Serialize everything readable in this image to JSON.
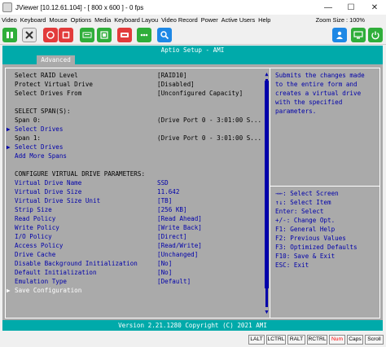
{
  "window": {
    "title": "JViewer [10.12.61.104] - [ 800 x 600 ] - 0 fps",
    "minimize": "—",
    "maximize": "☐",
    "close": "✕"
  },
  "menu": {
    "items": [
      "Video",
      "Keyboard",
      "Mouse",
      "Options",
      "Media",
      "Keyboard Layou",
      "Video Record",
      "Power",
      "Active Users",
      "Help"
    ],
    "zoom": "Zoom Size : 100%"
  },
  "toolbar": {
    "buttons": [
      "pause-icon",
      "settings-icon",
      "record-icon",
      "stop-icon",
      "keyboard-icon",
      "media-icon",
      "hard-disk-icon",
      "zoom-icon",
      "user-icon",
      "monitor-icon",
      "power-icon"
    ]
  },
  "bios": {
    "header": "Aptio Setup - AMI",
    "tab": "Advanced",
    "footer": "Version 2.21.1280 Copyright (C) 2021 AMI",
    "rows": [
      {
        "label": "Select RAID Level",
        "value": "[RAID10]"
      },
      {
        "label": "Protect Virtual Drive",
        "value": "[Disabled]"
      },
      {
        "label": "Select Drives From",
        "value": "[Unconfigured Capacity]"
      },
      {
        "label": "SELECT SPAN(S):",
        "value": ""
      },
      {
        "label": "Span 0:",
        "value": "(Drive Port 0 - 3:01:00 S..."
      },
      {
        "label": "Select Drives",
        "value": ""
      },
      {
        "label": "Span 1:",
        "value": "(Drive Port 0 - 3:01:00 S..."
      },
      {
        "label": "Select Drives",
        "value": ""
      },
      {
        "label": "Add More Spans",
        "value": ""
      },
      {
        "label": "CONFIGURE VIRTUAL DRIVE PARAMETERS:",
        "value": ""
      },
      {
        "label": "Virtual Drive Name",
        "value": "SSD"
      },
      {
        "label": "Virtual Drive Size",
        "value": "11.642"
      },
      {
        "label": "Virtual Drive Size Unit",
        "value": "[TB]"
      },
      {
        "label": "Strip Size",
        "value": "[256 KB]"
      },
      {
        "label": "Read Policy",
        "value": "[Read Ahead]"
      },
      {
        "label": "Write Policy",
        "value": "[Write Back]"
      },
      {
        "label": "I/O Policy",
        "value": "[Direct]"
      },
      {
        "label": "Access Policy",
        "value": "[Read/Write]"
      },
      {
        "label": "Drive Cache",
        "value": "[Unchanged]"
      },
      {
        "label": "Disable Background Initialization",
        "value": "[No]"
      },
      {
        "label": "Default Initialization",
        "value": "[No]"
      },
      {
        "label": "Emulation Type",
        "value": "[Default]"
      },
      {
        "label": "Save Configuration",
        "value": ""
      }
    ],
    "arrows": {
      "submenu": "▶"
    },
    "help": [
      "Submits the changes made",
      "to the entire form and",
      "creates a virtual drive",
      "with the specified",
      "parameters."
    ],
    "keys": [
      "→←: Select Screen",
      "↑↓: Select Item",
      "Enter: Select",
      "+/-: Change Opt.",
      "F1: General Help",
      "F2: Previous Values",
      "F3: Optimized Defaults",
      "F10: Save & Exit",
      "ESC: Exit"
    ]
  },
  "statusbar": {
    "keys": [
      "LALT",
      "LCTRL",
      "RALT",
      "RCTRL",
      "Num",
      "Caps",
      "Scroll"
    ]
  },
  "colors": {
    "bios_blue": "#0000aa",
    "bios_cyan": "#00aaaa",
    "bios_gray": "#aaaaaa",
    "num_lock_on": "#ff0000"
  }
}
